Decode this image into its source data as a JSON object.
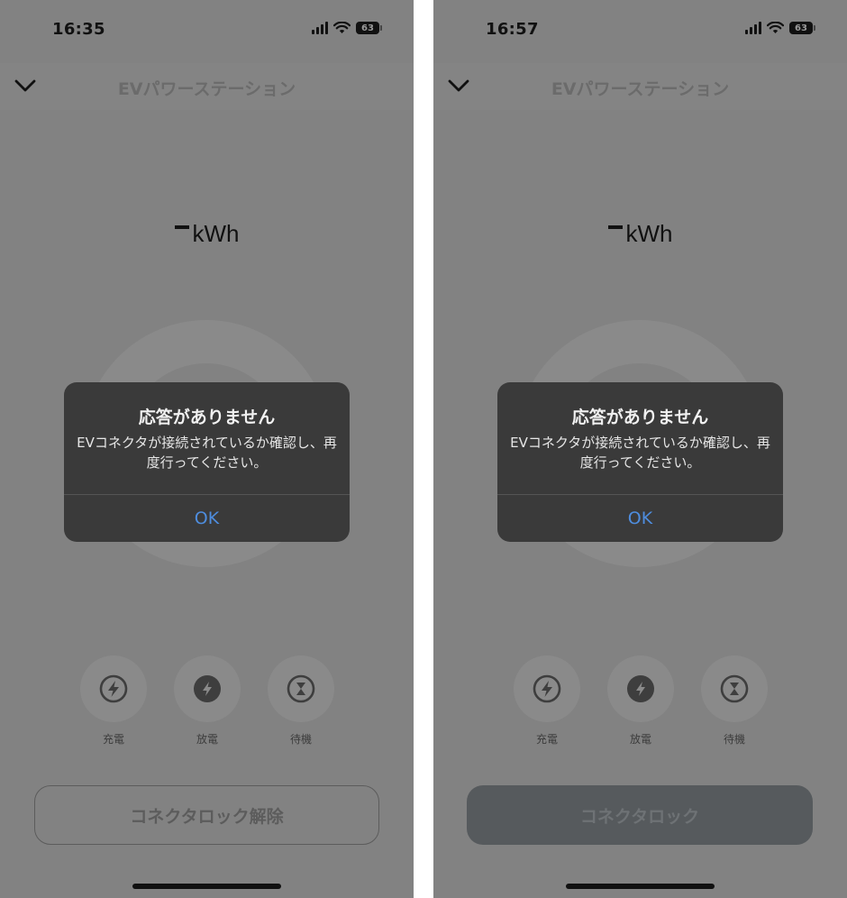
{
  "screens": [
    {
      "time": "16:35",
      "battery": "63",
      "nav_title": "EVパワーステーション",
      "energy_unit": "kWh",
      "dialog": {
        "title": "応答がありません",
        "message": "EVコネクタが接続されているか確認し、再度行ってください。",
        "ok": "OK"
      },
      "modes": [
        "充電",
        "放電",
        "待機"
      ],
      "action_button": "コネクタロック解除"
    },
    {
      "time": "16:57",
      "battery": "63",
      "nav_title": "EVパワーステーション",
      "energy_unit": "kWh",
      "dialog": {
        "title": "応答がありません",
        "message": "EVコネクタが接続されているか確認し、再度行ってください。",
        "ok": "OK"
      },
      "modes": [
        "充電",
        "放電",
        "待機"
      ],
      "action_button": "コネクタロック"
    }
  ],
  "icons": {
    "back": "chevron-down-icon",
    "charge": "lightning-outline-icon",
    "discharge": "lightning-filled-icon",
    "standby": "hourglass-icon",
    "signal": "cellular-signal-icon",
    "wifi": "wifi-icon",
    "battery": "battery-icon"
  },
  "colors": {
    "overlay_bg": "#828282",
    "dialog_bg": "#3a3a3a",
    "ok_text": "#4e8dde",
    "filled_button": "#565a5d"
  }
}
